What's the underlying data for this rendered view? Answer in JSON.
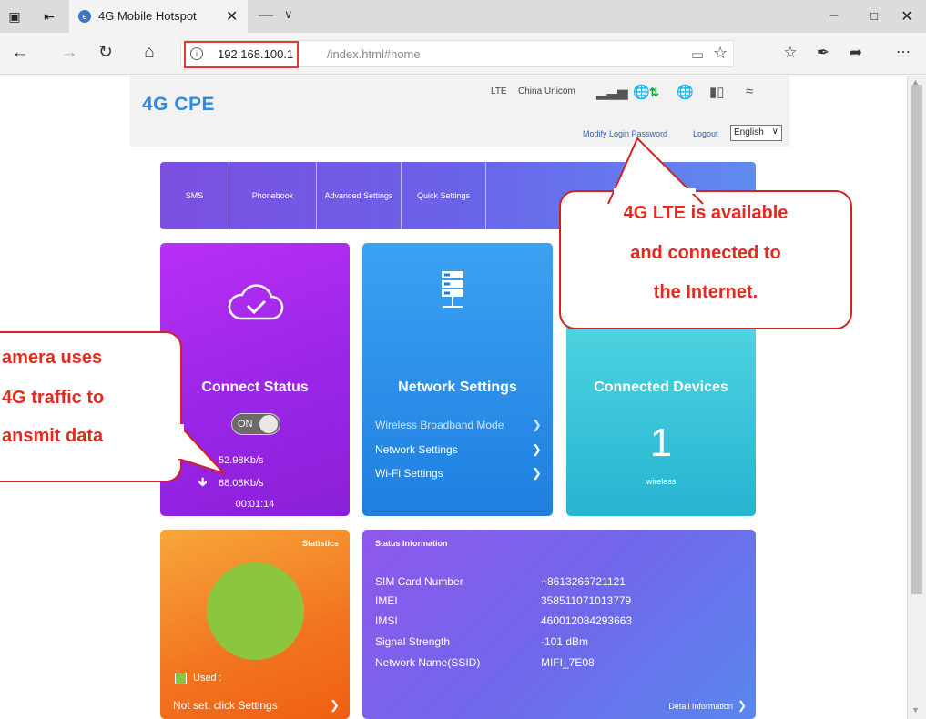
{
  "browser": {
    "tab_title": "4G Mobile Hotspot",
    "url_host": "192.168.100.1",
    "url_path": "/index.html#home"
  },
  "header": {
    "logo": "4G CPE",
    "network_type": "LTE",
    "carrier": "China Unicom",
    "modify_login_password": "Modify Login Password",
    "logout": "Logout",
    "language": "English"
  },
  "menu": {
    "items": [
      "SMS",
      "Phonebook",
      "Advanced Settings",
      "Quick Settings"
    ]
  },
  "connect": {
    "title": "Connect Status",
    "toggle_label": "ON",
    "upload_rate": "52.98Kb/s",
    "download_rate": "88.08Kb/s",
    "uptime": "00:01:14"
  },
  "network": {
    "title": "Network Settings",
    "links": [
      "Wireless Broadband Mode",
      "Network Settings",
      "Wi-Fi Settings"
    ]
  },
  "devices": {
    "title": "Connected Devices",
    "count": "1",
    "sub": "wireless"
  },
  "statistics": {
    "title": "Statistics",
    "legend_used": "Used :",
    "settings_link": "Not set, click Settings"
  },
  "status_info": {
    "title": "Status Information",
    "rows": [
      {
        "label": "SIM Card Number",
        "value": "+8613266721121"
      },
      {
        "label": "IMEI",
        "value": "358511071013779"
      },
      {
        "label": "IMSI",
        "value": "460012084293663"
      },
      {
        "label": "Signal Strength",
        "value": "-101 dBm"
      },
      {
        "label": "Network Name(SSID)",
        "value": "MIFI_7E08"
      }
    ],
    "detail_link": "Detail Information"
  },
  "callouts": {
    "lte": [
      "4G LTE is available",
      "and connected to",
      "the Internet."
    ],
    "camera": [
      "amera uses",
      "4G traffic to",
      "ansmit data"
    ]
  },
  "colors": {
    "accent_red": "#e42a1f",
    "logo_blue": "#2c8be0",
    "pie_used": "#8cc63e"
  }
}
